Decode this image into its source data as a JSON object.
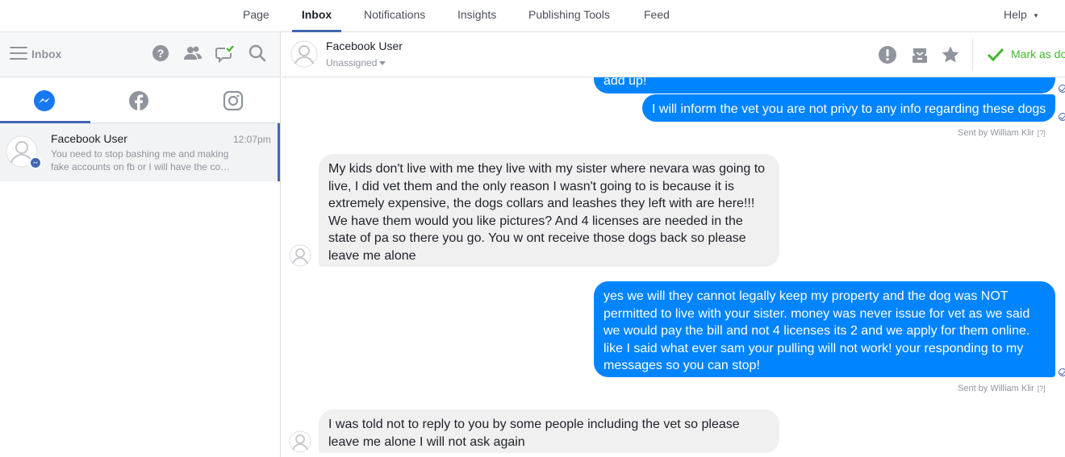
{
  "topnav": {
    "tabs": [
      "Page",
      "Inbox",
      "Notifications",
      "Insights",
      "Publishing Tools",
      "Feed"
    ],
    "active": "Inbox",
    "help": "Help"
  },
  "sidebar": {
    "title": "Inbox",
    "header_icons": [
      "help-icon",
      "people-icon",
      "messages-check-icon",
      "search-icon"
    ],
    "platform_tabs": [
      "messenger-icon",
      "facebook-icon",
      "instagram-icon"
    ],
    "active_platform": "messenger",
    "conversations": [
      {
        "name": "Facebook User",
        "time": "12:07pm",
        "preview": "You need to stop bashing me and making fake accounts on fb or I will have the co…"
      }
    ]
  },
  "conversation": {
    "name": "Facebook User",
    "assignment": "Unassigned",
    "actions": [
      "alert-icon",
      "archive-icon",
      "star-icon"
    ],
    "mark_done": "Mark as do",
    "messages": [
      {
        "direction": "out",
        "lines": [
          "add up!"
        ]
      },
      {
        "direction": "out",
        "lines": [
          "I will inform the vet you are not privy to any info regarding these dogs"
        ],
        "sent_by": "Sent by William Klir",
        "sent_by_help": "[?]"
      },
      {
        "direction": "in",
        "lines": [
          "My kids don't live with me they live with my sister where nevara was going to",
          "live, I did vet them and the only reason I wasn't going to is because it is",
          "extremely expensive, the dogs collars and leashes they left with are here!!!",
          "We have them would you like pictures? And 4 licenses are needed in the",
          "state of pa so there you go. You w ont receive those dogs back so please",
          "leave me alone"
        ]
      },
      {
        "direction": "out",
        "lines": [
          "yes we will they cannot legally keep my property and the dog was NOT",
          "permitted to live with your sister. money was never issue for vet as we said",
          "we would pay the bill and not 4 licenses its 2 and we apply for them online.",
          "like I said what ever sam your pulling will not work! your responding to my",
          "messages so you can stop!"
        ],
        "sent_by": "Sent by William Klir",
        "sent_by_help": "[?]"
      },
      {
        "direction": "in",
        "lines": [
          "I was told not to reply to you by some people including the vet so please",
          "leave me alone I will not ask again"
        ]
      }
    ]
  },
  "colors": {
    "accent": "#4267b2",
    "outgoing_bubble": "#0084ff",
    "incoming_bubble": "#f1f0f0",
    "done_green": "#42b72a",
    "messenger_blue": "#1877f2"
  }
}
